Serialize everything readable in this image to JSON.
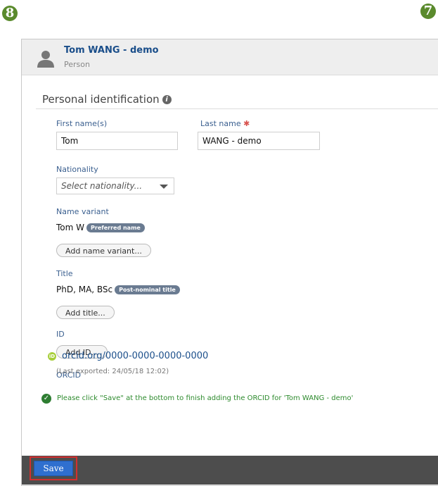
{
  "badges": {
    "left": "8",
    "right": "7"
  },
  "header": {
    "title": "Tom WANG - demo",
    "subtitle": "Person"
  },
  "section": {
    "title": "Personal identification"
  },
  "first_name": {
    "label": "First name(s)",
    "value": "Tom"
  },
  "last_name": {
    "label": "Last name",
    "required_mark": "✱",
    "value": "WANG - demo"
  },
  "nationality": {
    "label": "Nationality",
    "placeholder": "Select nationality..."
  },
  "name_variant": {
    "label": "Name variant",
    "value": "Tom W",
    "tag": "Preferred name",
    "add_button": "Add name variant..."
  },
  "title_field": {
    "label": "Title",
    "value": "PhD, MA, BSc",
    "tag": "Post-nominal title",
    "add_button": "Add title..."
  },
  "id_field": {
    "label": "ID",
    "add_button": "Add ID..."
  },
  "orcid": {
    "label": "ORCID",
    "icon_text": "iD",
    "link": "orcid.org/0000-0000-0000-0000",
    "exported": "(Last exported: 24/05/18 12:02)"
  },
  "message": {
    "text": "Please click \"Save\" at the bottom to finish adding the ORCID for 'Tom WANG - demo'"
  },
  "footer": {
    "save_label": "Save"
  },
  "colors": {
    "accent": "#2f6fcf",
    "badge": "#5a8a2c",
    "orcid": "#a6ce39",
    "success": "#2e8b2e"
  }
}
